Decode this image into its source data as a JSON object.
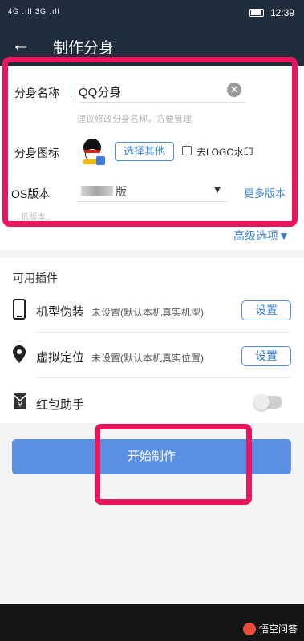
{
  "status_bar": {
    "signal": "4G .ıll 3G .ıll",
    "time": "12:39"
  },
  "app_bar": {
    "back_icon": "←",
    "title": "制作分身"
  },
  "form": {
    "name_label": "分身名称",
    "name_value": "QQ分身",
    "clear_icon": "✕",
    "name_hint": "建议修改分身名称，方便管理",
    "icon_label": "分身图标",
    "choose_other": "选择其他",
    "remove_logo": "去LOGO水印",
    "version_label": "OS版本",
    "version_value_suffix": "版",
    "dropdown_icon": "▼",
    "more_versions": "更多版本",
    "version_hint": "...低版本..."
  },
  "advanced": "高级选项▼",
  "plugins": {
    "title": "可用插件",
    "items": [
      {
        "name": "机型伪装",
        "status": "未设置(默认本机真实机型)",
        "button": "设置"
      },
      {
        "name": "虚拟定位",
        "status": "未设置(默认本机真实位置)",
        "button": "设置"
      },
      {
        "name": "红包助手"
      }
    ],
    "hongbao_toggle": false
  },
  "start_button": "开始制作",
  "watermark": "悟空问答",
  "colors": {
    "accent": "#3b7fcf",
    "highlight": "#e8175d",
    "header": "#1f2d3d",
    "start_button": "#5a8fe3"
  }
}
